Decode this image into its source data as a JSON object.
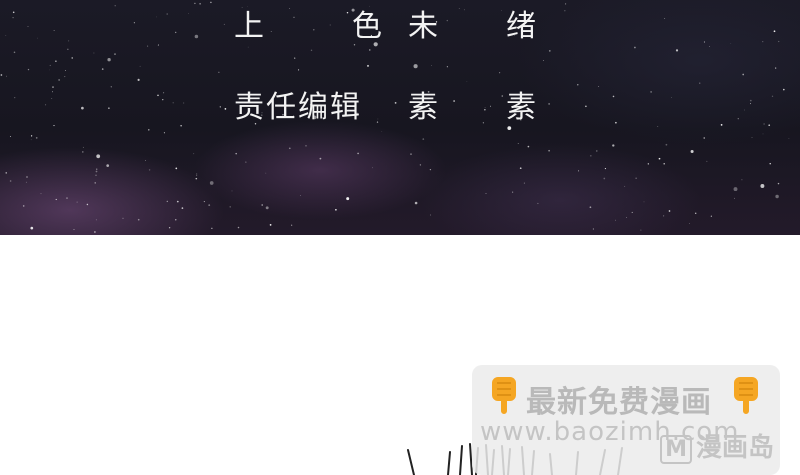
{
  "credits": {
    "coloring": {
      "label_chars": [
        "上",
        "色"
      ],
      "value_chars": [
        "未",
        "绪"
      ]
    },
    "editor": {
      "label": "责任编辑",
      "value_chars": [
        "素",
        "素"
      ]
    }
  },
  "watermark": {
    "promo_text": "最新免费漫画",
    "url_text": "www.baozimh.com",
    "logo_icon": "M",
    "logo_text": "漫画岛",
    "hand_icon": "pointing-down-hand-icon"
  },
  "colors": {
    "night_sky": "#1b1a26",
    "credit_text": "#f3f3f3",
    "watermark_text": "#b9b9b9",
    "hand_icon": "#f5a623"
  }
}
